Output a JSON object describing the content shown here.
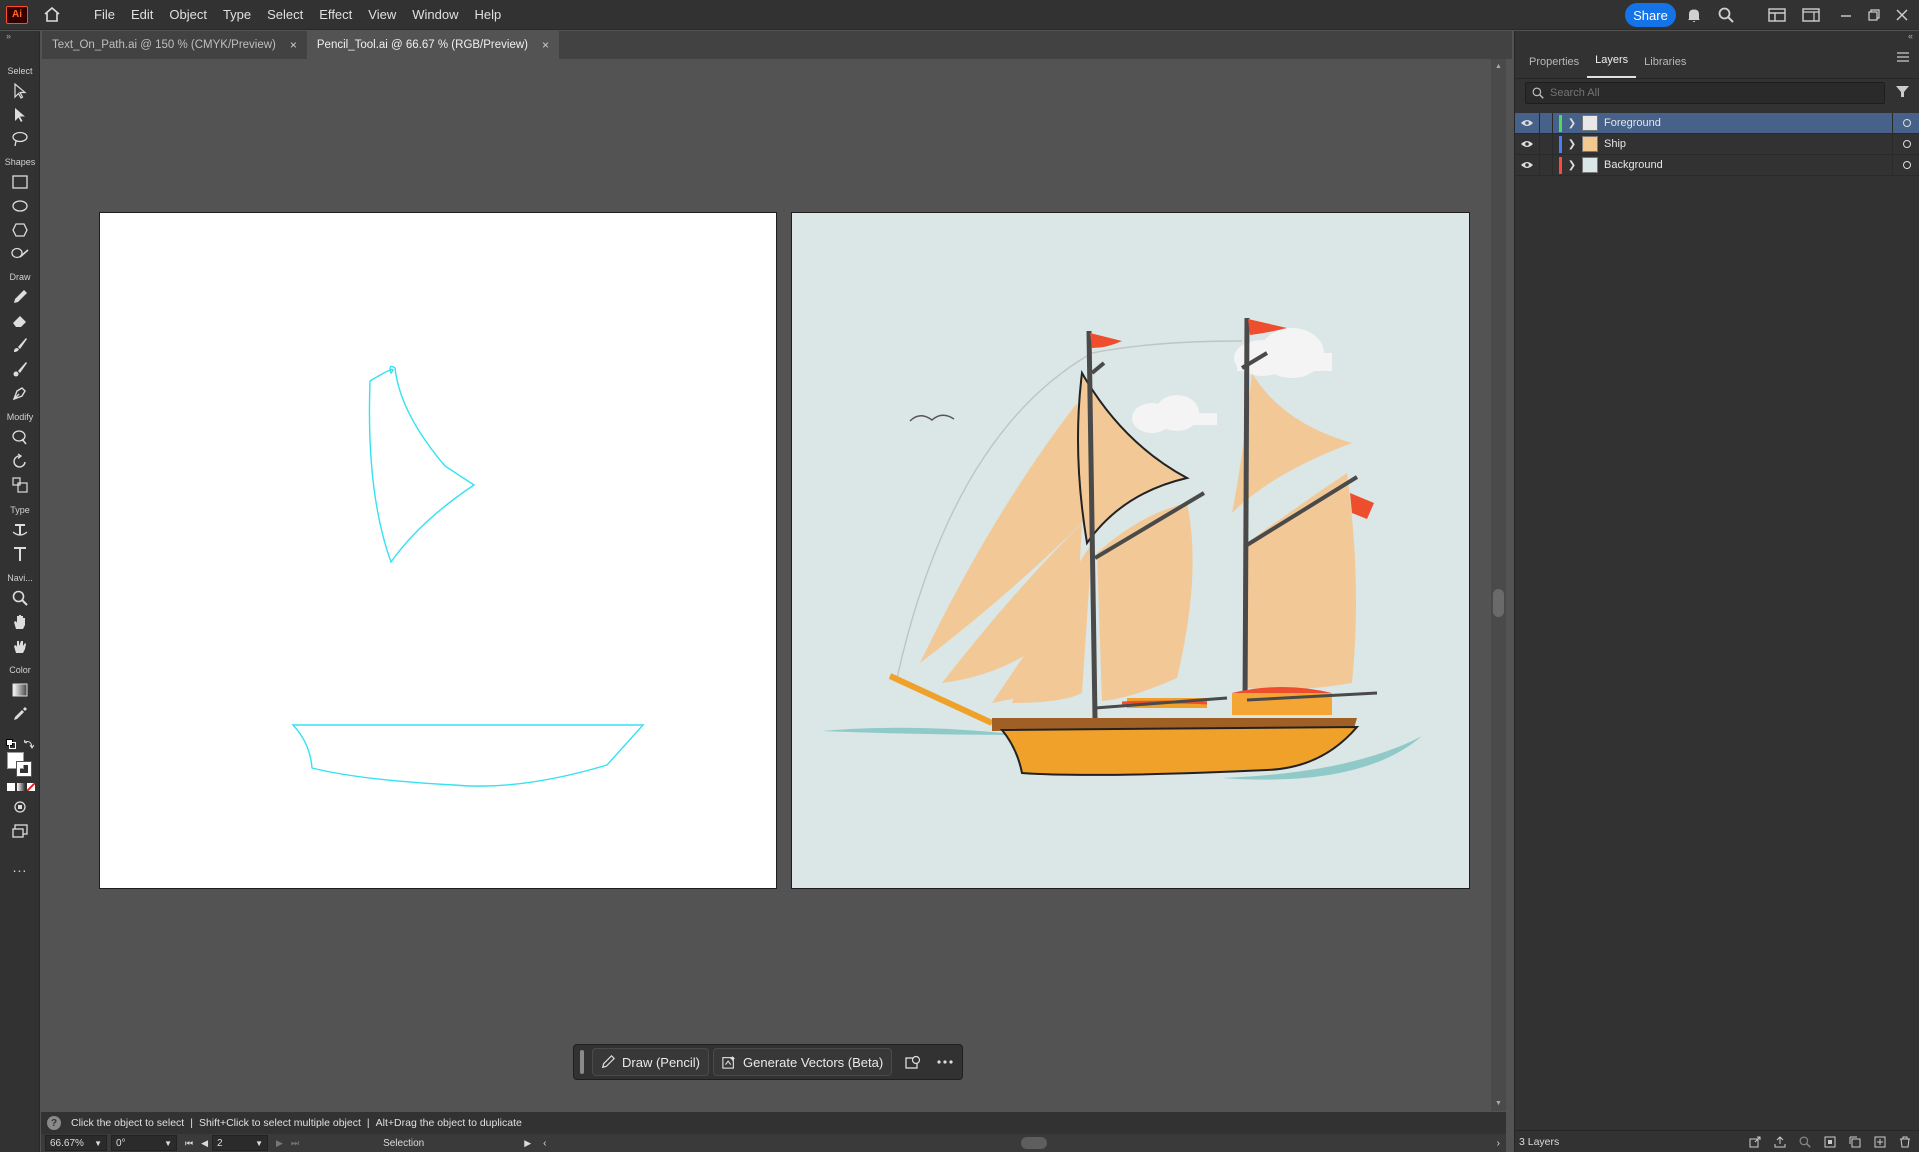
{
  "app": {
    "logo": "Ai"
  },
  "menu": [
    "File",
    "Edit",
    "Object",
    "Type",
    "Select",
    "Effect",
    "View",
    "Window",
    "Help"
  ],
  "share_label": "Share",
  "tabs": [
    {
      "label": "Text_On_Path.ai @ 150 % (CMYK/Preview)",
      "close": "×"
    },
    {
      "label": "Pencil_Tool.ai @ 66.67 % (RGB/Preview)",
      "close": "×"
    }
  ],
  "toolbar": {
    "select": "Select",
    "shapes": "Shapes",
    "draw": "Draw",
    "modify": "Modify",
    "type": "Type",
    "navigate": "Navi...",
    "color": "Color",
    "more": "..."
  },
  "context_bar": {
    "draw_label": "Draw (Pencil)",
    "generate_label": "Generate Vectors (Beta)"
  },
  "status": {
    "help": "?",
    "hint1": "Click the object to select",
    "hint2": "Shift+Click to select multiple object",
    "hint3": "Alt+Drag the object to duplicate",
    "separator": "|"
  },
  "bottom": {
    "zoom": "66.67%",
    "rotation": "0°",
    "artboard": "2",
    "tool": "Selection"
  },
  "panel": {
    "tabs": [
      "Properties",
      "Layers",
      "Libraries"
    ],
    "search_placeholder": "Search All",
    "layers": [
      {
        "name": "Foreground",
        "color": "#4cd964"
      },
      {
        "name": "Ship",
        "color": "#4a7dff"
      },
      {
        "name": "Background",
        "color": "#ff4a3a"
      }
    ],
    "layer_count": "3 Layers"
  }
}
